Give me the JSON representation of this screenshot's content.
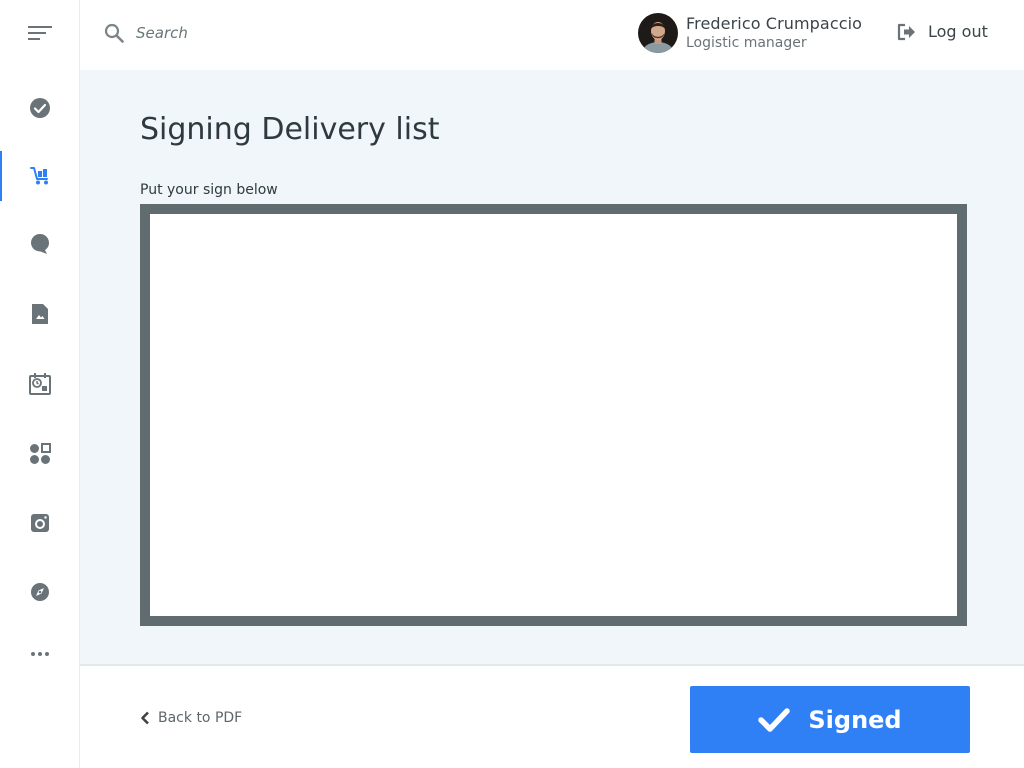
{
  "header": {
    "search": {
      "placeholder": "Search",
      "value": ""
    },
    "user": {
      "name": "Frederico Crumpaccio",
      "role": "Logistic manager"
    },
    "logout_label": "Log out"
  },
  "sidebar": {
    "items": [
      {
        "icon": "menu-icon",
        "active": false
      },
      {
        "icon": "check-circle-icon",
        "active": false
      },
      {
        "icon": "delivery-cart-icon",
        "active": true
      },
      {
        "icon": "chat-bubble-icon",
        "active": false
      },
      {
        "icon": "document-icon",
        "active": false
      },
      {
        "icon": "calendar-clock-icon",
        "active": false
      },
      {
        "icon": "apps-grid-icon",
        "active": false
      },
      {
        "icon": "camera-icon",
        "active": false
      },
      {
        "icon": "compass-icon",
        "active": false
      },
      {
        "icon": "more-icon",
        "active": false
      }
    ]
  },
  "main": {
    "title": "Signing Delivery list",
    "sign_label": "Put your sign below"
  },
  "footer": {
    "back_label": "Back to PDF",
    "signed_label": "Signed"
  },
  "colors": {
    "accent": "#2f80f5",
    "icon": "#6a7478",
    "background": "#f1f6fa",
    "pad_border": "#616c71"
  }
}
